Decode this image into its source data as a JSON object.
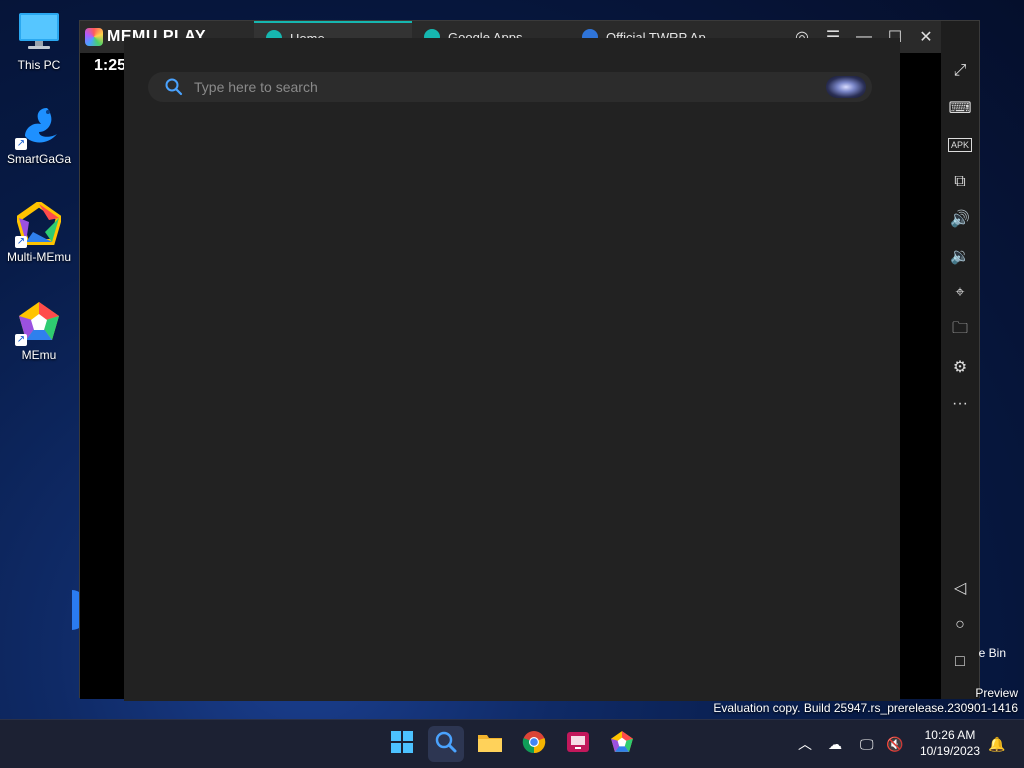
{
  "desktop": {
    "icons": [
      {
        "label": "This PC"
      },
      {
        "label": "SmartGaGa"
      },
      {
        "label": "Multi-MEmu"
      },
      {
        "label": "MEmu"
      }
    ],
    "recycle_bin_label": "e Bin"
  },
  "memu": {
    "logo_text": "MEMU PLAY",
    "tabs": [
      {
        "label": "Home"
      },
      {
        "label": "Google Apps"
      },
      {
        "label": "Official TWRP Ap..."
      }
    ],
    "status_time": "1:25"
  },
  "search": {
    "placeholder": "Type here to search"
  },
  "watermark": {
    "line1": "Preview",
    "line2": "Evaluation copy. Build 25947.rs_prerelease.230901-1416"
  },
  "taskbar": {
    "time": "10:26 AM",
    "date": "10/19/2023"
  },
  "colors": {
    "accent_teal": "#16b7b0",
    "overlay_bg": "#222222",
    "taskbar_bg": "#1c2133"
  }
}
